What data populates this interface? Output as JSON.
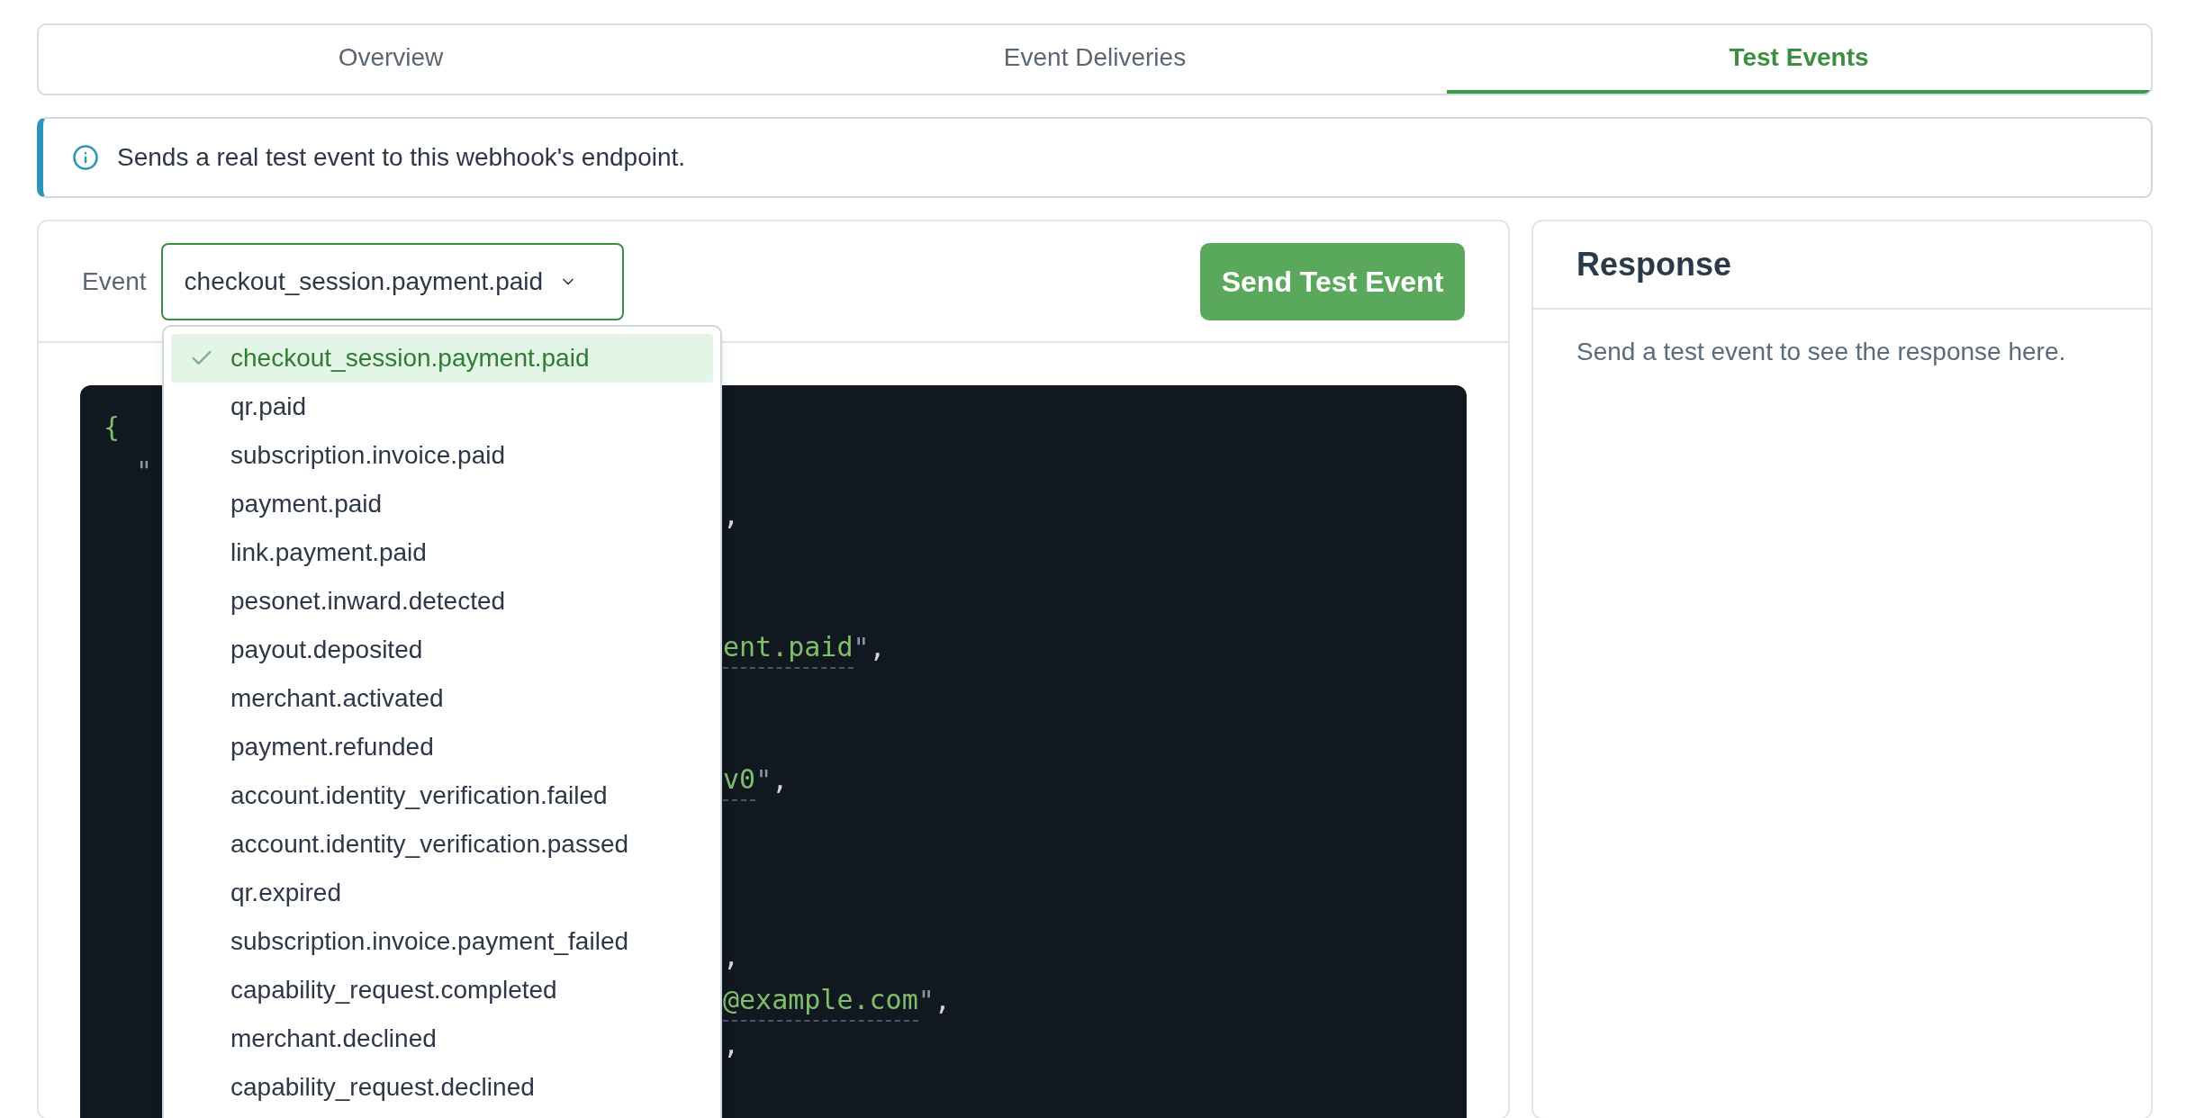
{
  "tabs": [
    {
      "label": "Overview",
      "selected": false
    },
    {
      "label": "Event Deliveries",
      "selected": false
    },
    {
      "label": "Test Events",
      "selected": true
    }
  ],
  "notice": {
    "text": "Sends a real test event to this webhook's endpoint."
  },
  "event_form": {
    "label": "Event",
    "select_value": "checkout_session.payment.paid",
    "button": "Send Test Event"
  },
  "dropdown": {
    "options": [
      {
        "label": "checkout_session.payment.paid",
        "selected": true
      },
      {
        "label": "qr.paid",
        "selected": false
      },
      {
        "label": "subscription.invoice.paid",
        "selected": false
      },
      {
        "label": "payment.paid",
        "selected": false
      },
      {
        "label": "link.payment.paid",
        "selected": false
      },
      {
        "label": "pesonet.inward.detected",
        "selected": false
      },
      {
        "label": "payout.deposited",
        "selected": false
      },
      {
        "label": "merchant.activated",
        "selected": false
      },
      {
        "label": "payment.refunded",
        "selected": false
      },
      {
        "label": "account.identity_verification.failed",
        "selected": false
      },
      {
        "label": "account.identity_verification.passed",
        "selected": false
      },
      {
        "label": "qr.expired",
        "selected": false
      },
      {
        "label": "subscription.invoice.payment_failed",
        "selected": false
      },
      {
        "label": "capability_request.completed",
        "selected": false
      },
      {
        "label": "merchant.declined",
        "selected": false
      },
      {
        "label": "capability_request.declined",
        "selected": false
      }
    ]
  },
  "code_lines": [
    {
      "kind": "open",
      "segments": [
        {
          "text": "{",
          "kind": "brace"
        }
      ]
    },
    {
      "kind": "key",
      "segments": [
        {
          "text": "\"",
          "kind": "quote"
        }
      ]
    },
    {
      "kind": "tail",
      "segments": [
        {
          "text": ",",
          "kind": "punct"
        }
      ]
    },
    {
      "kind": "covered"
    },
    {
      "kind": "covered"
    },
    {
      "kind": "tail",
      "segments": [
        {
          "text": "ent.paid",
          "kind": "string"
        },
        {
          "text": "\"",
          "kind": "quote"
        },
        {
          "text": ",",
          "kind": "punct"
        }
      ]
    },
    {
      "kind": "covered"
    },
    {
      "kind": "covered"
    },
    {
      "kind": "tail",
      "segments": [
        {
          "text": "v0",
          "kind": "string"
        },
        {
          "text": "\"",
          "kind": "quote"
        },
        {
          "text": ",",
          "kind": "punct"
        }
      ]
    },
    {
      "kind": "covered"
    },
    {
      "kind": "covered"
    },
    {
      "kind": "covered"
    },
    {
      "kind": "tail",
      "segments": [
        {
          "text": ",",
          "kind": "punct"
        }
      ]
    },
    {
      "kind": "tail",
      "segments": [
        {
          "text": "@example.com",
          "kind": "string"
        },
        {
          "text": "\"",
          "kind": "quote"
        },
        {
          "text": ",",
          "kind": "punct"
        }
      ]
    },
    {
      "kind": "tail",
      "segments": [
        {
          "text": ",",
          "kind": "punct"
        }
      ]
    }
  ],
  "response": {
    "title": "Response",
    "message": "Send a test event to see the response here."
  }
}
